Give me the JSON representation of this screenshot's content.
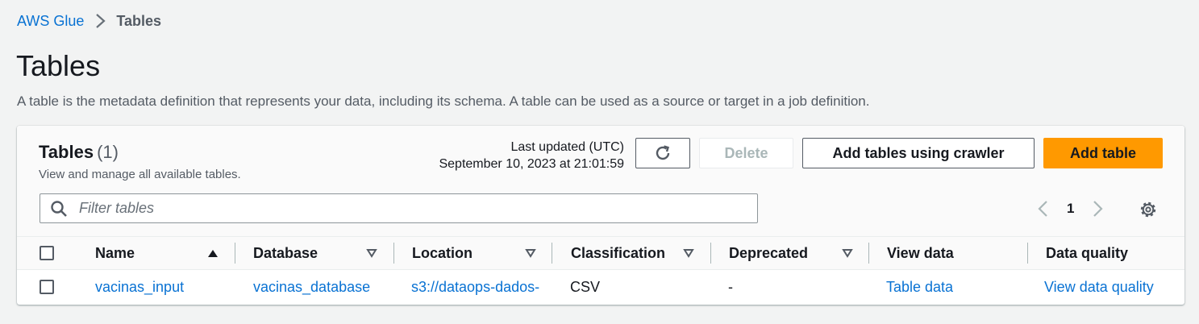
{
  "breadcrumb": {
    "root": "AWS Glue",
    "current": "Tables"
  },
  "page": {
    "title": "Tables",
    "description": "A table is the metadata definition that represents your data, including its schema. A table can be used as a source or target in a job definition."
  },
  "container": {
    "title": "Tables",
    "count": "(1)",
    "description": "View and manage all available tables.",
    "last_updated_label": "Last updated (UTC)",
    "last_updated_value": "September 10, 2023 at 21:01:59",
    "buttons": {
      "delete": "Delete",
      "add_crawler": "Add tables using crawler",
      "add_table": "Add table"
    },
    "filter_placeholder": "Filter tables",
    "page_number": "1"
  },
  "table": {
    "columns": [
      "Name",
      "Database",
      "Location",
      "Classification",
      "Deprecated",
      "View data",
      "Data quality"
    ],
    "rows": [
      {
        "name": "vacinas_input",
        "database": "vacinas_database",
        "location": "s3://dataops-dados-",
        "classification": "CSV",
        "deprecated": "-",
        "view_data": "Table data",
        "data_quality": "View data quality"
      }
    ]
  },
  "colors": {
    "link": "#0972d3",
    "primary": "#ff9900",
    "text": "#16191f",
    "muted": "#545b64"
  },
  "icons": [
    "chevron-right-icon",
    "refresh-icon",
    "search-icon",
    "chevron-left-icon",
    "settings-gear-icon",
    "sort-ascending-icon",
    "sort-descending-icon"
  ]
}
